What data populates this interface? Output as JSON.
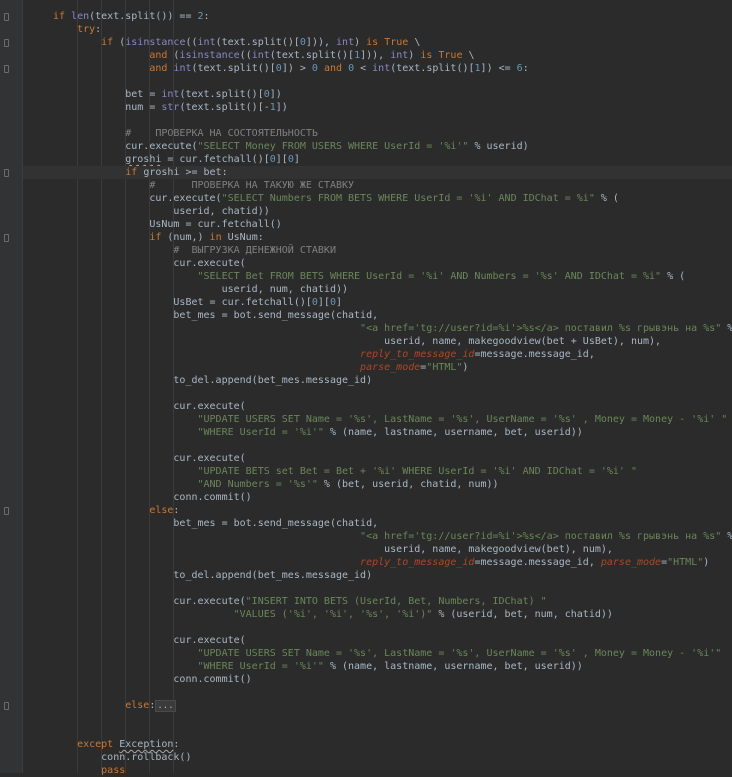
{
  "editor": {
    "line_count": 59,
    "lines": [
      [
        [
          "kw",
          "if "
        ],
        [
          "bi",
          "len"
        ],
        [
          "p",
          "(text.split()) == "
        ],
        [
          "num",
          "2"
        ],
        [
          "p",
          ":"
        ]
      ],
      [
        [
          "kw",
          "    try"
        ],
        [
          "p",
          ":"
        ]
      ],
      [
        [
          "kw",
          "        if "
        ],
        [
          "p",
          "("
        ],
        [
          "bi",
          "isinstance"
        ],
        [
          "p",
          "(("
        ],
        [
          "bi",
          "int"
        ],
        [
          "p",
          "(text.split()["
        ],
        [
          "num",
          "0"
        ],
        [
          "p",
          "])), "
        ],
        [
          "bi",
          "int"
        ],
        [
          "p",
          ") "
        ],
        [
          "kw",
          "is True "
        ],
        [
          "p",
          "\\"
        ]
      ],
      [
        [
          "kw",
          "                and "
        ],
        [
          "p",
          "("
        ],
        [
          "bi",
          "isinstance"
        ],
        [
          "p",
          "(("
        ],
        [
          "bi",
          "int"
        ],
        [
          "p",
          "(text.split()["
        ],
        [
          "num",
          "1"
        ],
        [
          "p",
          "])), "
        ],
        [
          "bi",
          "int"
        ],
        [
          "p",
          ") "
        ],
        [
          "kw",
          "is True "
        ],
        [
          "p",
          "\\"
        ]
      ],
      [
        [
          "kw",
          "                and "
        ],
        [
          "bi",
          "int"
        ],
        [
          "p",
          "(text.split()["
        ],
        [
          "num",
          "0"
        ],
        [
          "p",
          "]) > "
        ],
        [
          "num",
          "0 "
        ],
        [
          "kw",
          "and "
        ],
        [
          "num",
          "0 "
        ],
        [
          "p",
          "< "
        ],
        [
          "bi",
          "int"
        ],
        [
          "p",
          "(text.split()["
        ],
        [
          "num",
          "1"
        ],
        [
          "p",
          "]) <= "
        ],
        [
          "num",
          "6"
        ],
        [
          "p",
          ":"
        ]
      ],
      [],
      [
        [
          "p",
          "            bet = "
        ],
        [
          "bi",
          "int"
        ],
        [
          "p",
          "(text.split()["
        ],
        [
          "num",
          "0"
        ],
        [
          "p",
          "])"
        ]
      ],
      [
        [
          "p",
          "            num = "
        ],
        [
          "bi",
          "str"
        ],
        [
          "p",
          "(text.split()[-"
        ],
        [
          "num",
          "1"
        ],
        [
          "p",
          "])"
        ]
      ],
      [],
      [
        [
          "cmt",
          "            #    ПРОВЕРКА НА СОСТОЯТЕЛЬНОСТЬ"
        ]
      ],
      [
        [
          "p",
          "            cur.execute("
        ],
        [
          "str",
          "\"SELECT Money FROM USERS WHERE UserId = '%i'\""
        ],
        [
          "p",
          " % userid)"
        ]
      ],
      [
        [
          "p",
          "            "
        ],
        [
          "sq",
          "groshi"
        ],
        [
          "p",
          " = cur.fetchall()["
        ],
        [
          "num",
          "0"
        ],
        [
          "p",
          "]["
        ],
        [
          "num",
          "0"
        ],
        [
          "p",
          "]"
        ]
      ],
      [
        [
          "kw",
          "            if "
        ],
        [
          "p",
          "groshi >= bet:"
        ]
      ],
      [
        [
          "cmt",
          "                #      ПРОВЕРКА НА ТАКУЮ ЖЕ СТАВКУ"
        ]
      ],
      [
        [
          "p",
          "                cur.execute("
        ],
        [
          "str",
          "\"SELECT Numbers FROM BETS WHERE UserId = '%i' AND IDChat = %i\""
        ],
        [
          "p",
          " % ("
        ]
      ],
      [
        [
          "p",
          "                    userid, chatid))"
        ]
      ],
      [
        [
          "p",
          "                UsNum = cur.fetchall()"
        ]
      ],
      [
        [
          "kw",
          "                if "
        ],
        [
          "p",
          "(num,) "
        ],
        [
          "kw",
          "in "
        ],
        [
          "p",
          "UsNum:"
        ]
      ],
      [
        [
          "cmt",
          "                    #  ВЫГРУЗКА ДЕНЕЖНОЙ СТАВКИ"
        ]
      ],
      [
        [
          "p",
          "                    cur.execute("
        ]
      ],
      [
        [
          "str",
          "                        \"SELECT Bet FROM BETS WHERE UserId = '%i' AND Numbers = '%s' AND IDChat = %i\""
        ],
        [
          "p",
          " % ("
        ]
      ],
      [
        [
          "p",
          "                            userid, num, chatid))"
        ]
      ],
      [
        [
          "p",
          "                    UsBet = cur.fetchall()["
        ],
        [
          "num",
          "0"
        ],
        [
          "p",
          "]["
        ],
        [
          "num",
          "0"
        ],
        [
          "p",
          "]"
        ]
      ],
      [
        [
          "p",
          "                    bet_mes = bot.send_message(chatid,"
        ]
      ],
      [
        [
          "str",
          "                                                   \"<a href='tg://user?id=%i'>%s</a> поставил %s грывэнь на %s\""
        ],
        [
          "p",
          " % ("
        ]
      ],
      [
        [
          "p",
          "                                                       userid, name, makegoodview(bet + UsBet), num),"
        ]
      ],
      [
        [
          "nm",
          "                                                   reply_to_message_id"
        ],
        [
          "p",
          "=message.message_id,"
        ]
      ],
      [
        [
          "nm",
          "                                                   parse_mode"
        ],
        [
          "p",
          "="
        ],
        [
          "str",
          "\"HTML\""
        ],
        [
          "p",
          ")"
        ]
      ],
      [
        [
          "p",
          "                    to_del.append(bet_mes.message_id)"
        ]
      ],
      [],
      [
        [
          "p",
          "                    cur.execute("
        ]
      ],
      [
        [
          "str",
          "                        \"UPDATE USERS SET Name = '%s', LastName = '%s', UserName = '%s' , Money = Money - '%i' \""
        ]
      ],
      [
        [
          "str",
          "                        \"WHERE UserId = '%i'\""
        ],
        [
          "p",
          " % (name, lastname, username, bet, userid))"
        ]
      ],
      [],
      [
        [
          "p",
          "                    cur.execute("
        ]
      ],
      [
        [
          "str",
          "                        \"UPDATE BETS set Bet = Bet + '%i' WHERE UserId = '%i' AND IDChat = '%i' \""
        ]
      ],
      [
        [
          "str",
          "                        \"AND Numbers = '%s'\""
        ],
        [
          "p",
          " % (bet, userid, chatid, num))"
        ]
      ],
      [
        [
          "p",
          "                    conn.commit()"
        ]
      ],
      [
        [
          "kw",
          "                else"
        ],
        [
          "p",
          ":"
        ]
      ],
      [
        [
          "p",
          "                    bet_mes = bot.send_message(chatid,"
        ]
      ],
      [
        [
          "str",
          "                                                   \"<a href='tg://user?id=%i'>%s</a> поставил %s грывэнь на %s\""
        ],
        [
          "p",
          " % ("
        ]
      ],
      [
        [
          "p",
          "                                                       userid, name, makegoodview(bet), num),"
        ]
      ],
      [
        [
          "nm",
          "                                                   reply_to_message_id"
        ],
        [
          "p",
          "=message.message_id, "
        ],
        [
          "nm",
          "parse_mode"
        ],
        [
          "p",
          "="
        ],
        [
          "str",
          "\"HTML\""
        ],
        [
          "p",
          ")"
        ]
      ],
      [
        [
          "p",
          "                    to_del.append(bet_mes.message_id)"
        ]
      ],
      [],
      [
        [
          "p",
          "                    cur.execute("
        ],
        [
          "str",
          "\"INSERT INTO BETS (UserId, Bet, Numbers, IDChat) \""
        ]
      ],
      [
        [
          "str",
          "                              \"VALUES ('%i', '%i', '%s', '%i')\""
        ],
        [
          "p",
          " % (userid, bet, num, chatid))"
        ]
      ],
      [],
      [
        [
          "p",
          "                    cur.execute("
        ]
      ],
      [
        [
          "str",
          "                        \"UPDATE USERS SET Name = '%s', LastName = '%s', UserName = '%s' , Money = Money - '%i'\""
        ]
      ],
      [
        [
          "str",
          "                        \"WHERE UserId = '%i'\""
        ],
        [
          "p",
          " % (name, lastname, username, bet, userid))"
        ]
      ],
      [
        [
          "p",
          "                    conn.commit()"
        ]
      ],
      [],
      [
        [
          "kw",
          "            else"
        ],
        [
          "p",
          ":"
        ],
        [
          "fold",
          "..."
        ]
      ],
      [],
      [],
      [
        [
          "kw",
          "    except "
        ],
        [
          "sq",
          "Exception"
        ],
        [
          "p",
          ":"
        ]
      ],
      [
        [
          "p",
          "        conn.rollback()"
        ]
      ],
      [
        [
          "kw",
          "        pass"
        ]
      ]
    ],
    "highlighted_line_index": 12,
    "fold_marker_lines": [
      0,
      2,
      4,
      12,
      17,
      38,
      53
    ]
  }
}
